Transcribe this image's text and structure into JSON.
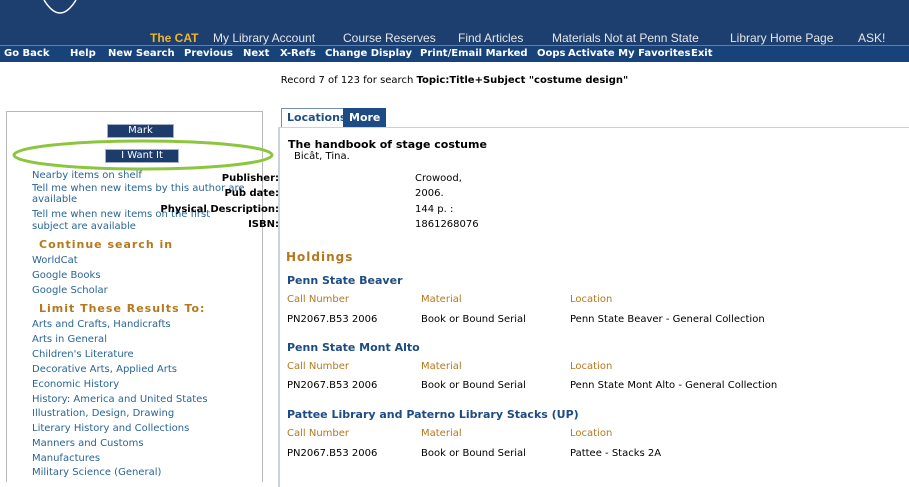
{
  "top_nav": {
    "items": [
      "The CAT",
      "My Library Account",
      "Course Reserves",
      "Find Articles",
      "Materials Not at Penn State",
      "Library Home Page",
      "ASK!"
    ],
    "active_index": 0
  },
  "command_bar": [
    "Go Back",
    "Help",
    "New Search",
    "Previous",
    "Next",
    "X-Refs",
    "Change Display",
    "Print/Email Marked",
    "Oops",
    "Activate My Favorites",
    "Exit"
  ],
  "record_line": {
    "prefix": "Record 7 of 123 for search ",
    "search": "Topic:Title+Subject \"costume design\""
  },
  "sidebar": {
    "mark_label": "Mark",
    "want_label": "I Want It",
    "links": [
      "Nearby items on shelf",
      "Tell me when new items by this author are",
      "available",
      "Tell me when new items on the first",
      "subject are available"
    ],
    "continue_heading": "Continue search in",
    "continue_links": [
      "WorldCat",
      "Google Books",
      "Google Scholar"
    ],
    "limit_heading": "Limit These Results To:",
    "limit_links": [
      "Arts and Crafts, Handicrafts",
      "Arts in General",
      "Children's Literature",
      "Decorative Arts, Applied Arts",
      "Economic History",
      "History: America and United States",
      "Illustration, Design, Drawing",
      "Literary History and Collections",
      "Manners and Customs",
      "Manufactures",
      "Military Science (General)"
    ]
  },
  "tabs": {
    "locations": "Locations",
    "more": "More ..."
  },
  "record": {
    "title": "The handbook of stage costume",
    "author": "Bicât, Tina.",
    "meta": [
      {
        "label": "Publisher:",
        "value": "Crowood,"
      },
      {
        "label": "Pub date:",
        "value": "2006."
      },
      {
        "label": "Physical Description:",
        "value": "144 p. :"
      },
      {
        "label": "ISBN:",
        "value": "1861268076"
      }
    ]
  },
  "holdings": {
    "heading": "Holdings",
    "columns": [
      "Call Number",
      "Material",
      "Location"
    ],
    "libraries": [
      {
        "name": "Penn State Beaver",
        "call_number": "PN2067.B53 2006",
        "material": "Book or Bound Serial",
        "location": "Penn State Beaver - General Collection"
      },
      {
        "name": "Penn State Mont Alto",
        "call_number": "PN2067.B53 2006",
        "material": "Book or Bound Serial",
        "location": "Penn State Mont Alto - General Collection"
      },
      {
        "name": "Pattee Library and Paterno Library Stacks (UP)",
        "call_number": "PN2067.B53 2006",
        "material": "Book or Bound Serial",
        "location": "Pattee - Stacks 2A"
      }
    ]
  },
  "colors": {
    "nav_bg": "#1c3f6f",
    "accent_gold": "#b5781c",
    "link_blue": "#2a6595",
    "highlight_green": "#8cc63f"
  }
}
